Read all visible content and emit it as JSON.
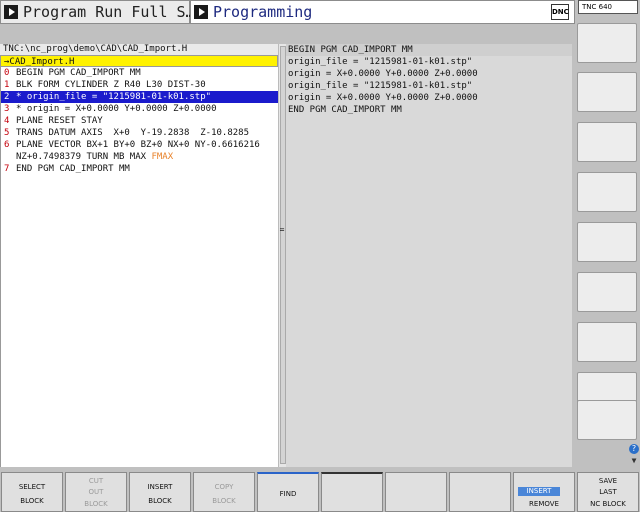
{
  "header": {
    "mode_label": "Program Run Full S…",
    "prog_label": "Programming",
    "dnc": "DNC"
  },
  "side": {
    "logo": "TNC 640"
  },
  "editor": {
    "path": "TNC:\\nc_prog\\demo\\CAD\\CAD_Import.H",
    "file_tab": "→CAD_Import.H",
    "lines": [
      {
        "n": "0",
        "text": "BEGIN PGM CAD_IMPORT MM"
      },
      {
        "n": "1",
        "text": "BLK FORM CYLINDER Z R40 L30 DIST-30"
      },
      {
        "n": "2",
        "text": "* origin_file = \"1215981-01-k01.stp\""
      },
      {
        "n": "3",
        "text": "* origin = X+0.0000 Y+0.0000 Z+0.0000"
      },
      {
        "n": "4",
        "text": "PLANE RESET STAY"
      },
      {
        "n": "5",
        "text": "TRANS DATUM AXIS  X+0  Y-19.2838  Z-10.8285"
      },
      {
        "n": "6",
        "text": "PLANE VECTOR BX+1 BY+0 BZ+0 NX+0 NY-0.6616216"
      },
      {
        "n": "",
        "text": "NZ+0.7498379 TURN MB MAX ",
        "fmax": "FMAX"
      },
      {
        "n": "7",
        "text": "END PGM CAD_IMPORT MM"
      }
    ],
    "selected_index": 2
  },
  "preview": {
    "lines": [
      "BEGIN PGM CAD_IMPORT MM",
      "origin_file = \"1215981-01-k01.stp\"",
      "origin = X+0.0000 Y+0.0000 Z+0.0000",
      "origin_file = \"1215981-01-k01.stp\"",
      "origin = X+0.0000 Y+0.0000 Z+0.0000",
      "END PGM CAD_IMPORT MM"
    ]
  },
  "softkeys": {
    "select_l1": "SELECT",
    "select_l2": "BLOCK",
    "cut_l0": "CUT",
    "cut_l1": "OUT",
    "cut_l2": "BLOCK",
    "insert_l1": "INSERT",
    "insert_l2": "BLOCK",
    "copy_l1": "COPY",
    "copy_l2": "BLOCK",
    "find": "FIND",
    "insert_toggle": "INSERT",
    "remove": "REMOVE",
    "last_l0": "SAVE",
    "last_l1": "LAST",
    "last_l2": "NC BLOCK"
  },
  "colors": {
    "selection": "#1b1bcc",
    "file_tab": "#fff200",
    "line_numbers": "#c4000c",
    "fmax": "#e8822a"
  }
}
